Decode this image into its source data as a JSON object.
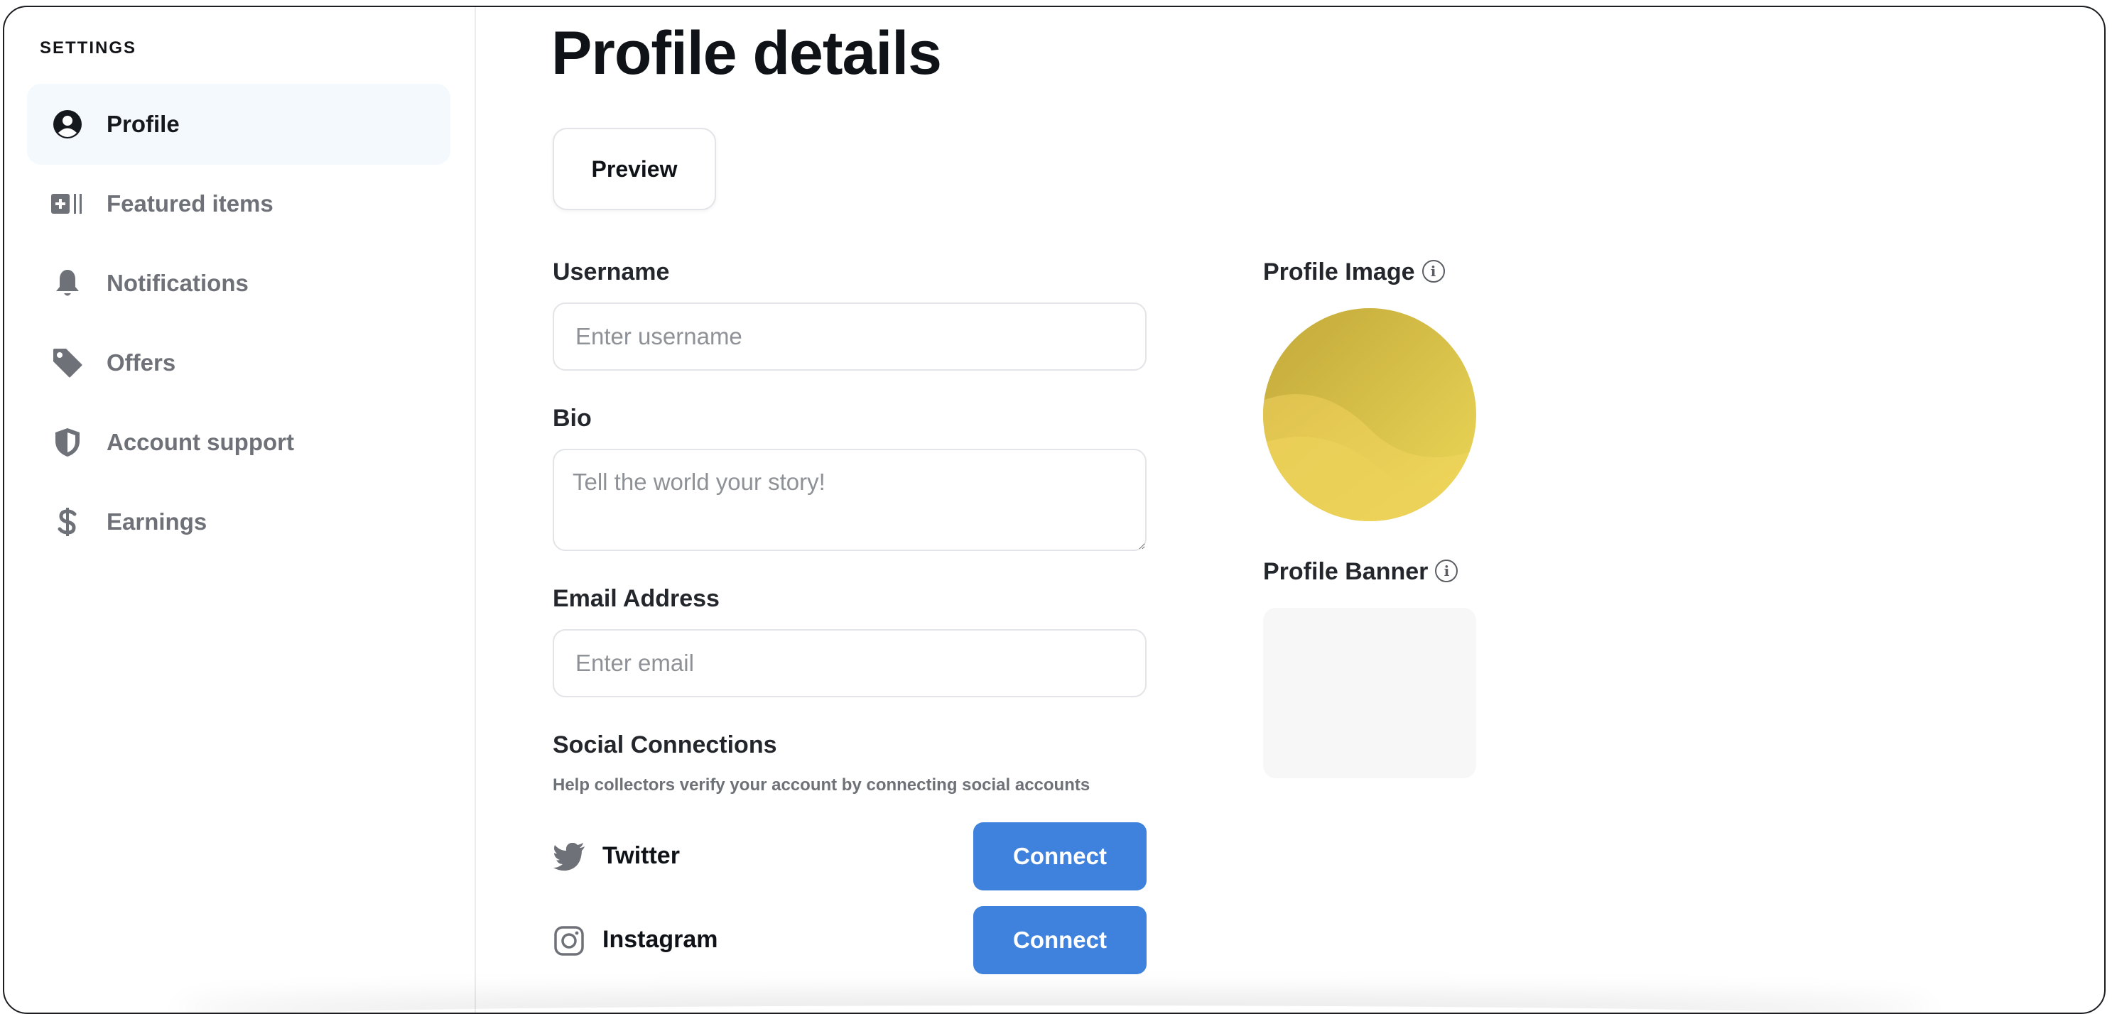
{
  "sidebar": {
    "heading": "SETTINGS",
    "items": [
      {
        "label": "Profile",
        "icon": "user-circle-icon",
        "active": true
      },
      {
        "label": "Featured items",
        "icon": "featured-items-icon",
        "active": false
      },
      {
        "label": "Notifications",
        "icon": "bell-icon",
        "active": false
      },
      {
        "label": "Offers",
        "icon": "tag-icon",
        "active": false
      },
      {
        "label": "Account support",
        "icon": "shield-icon",
        "active": false
      },
      {
        "label": "Earnings",
        "icon": "dollar-icon",
        "active": false
      }
    ]
  },
  "main": {
    "title": "Profile details",
    "preview_label": "Preview",
    "username": {
      "label": "Username",
      "placeholder": "Enter username",
      "value": ""
    },
    "bio": {
      "label": "Bio",
      "placeholder": "Tell the world your story!",
      "value": ""
    },
    "email": {
      "label": "Email Address",
      "placeholder": "Enter email",
      "value": ""
    },
    "social": {
      "heading": "Social Connections",
      "helper": "Help collectors verify your account by connecting social accounts",
      "items": [
        {
          "name": "Twitter",
          "icon": "twitter-icon",
          "button": "Connect"
        },
        {
          "name": "Instagram",
          "icon": "instagram-icon",
          "button": "Connect"
        }
      ]
    },
    "profile_image": {
      "label": "Profile Image",
      "info": "i"
    },
    "profile_banner": {
      "label": "Profile Banner",
      "info": "i"
    }
  },
  "colors": {
    "accent": "#3f82dd",
    "active_nav_bg": "#f4f9fe",
    "muted_text": "#6e7177",
    "avatar_gradient": [
      "#c9af3c",
      "#e6cf55"
    ]
  }
}
